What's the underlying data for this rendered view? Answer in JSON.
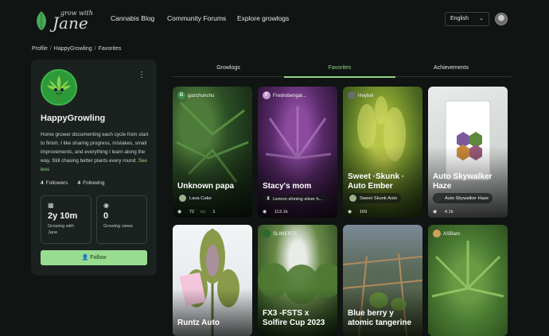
{
  "header": {
    "logo_small": "grow with",
    "logo_big": "Jane",
    "nav": [
      "Cannabis Blog",
      "Community Forums",
      "Explore growlogs"
    ],
    "language": "English"
  },
  "breadcrumb": [
    "Profile",
    "HappyGrowling",
    "Favorites"
  ],
  "profile": {
    "name": "HappyGrowling",
    "bio": "Home grower documenting each cycle from start to finish. I like sharing progress, mistakes, small improvements, and everything I learn along the way. Still chasing better plants every round.",
    "see_less": "See less",
    "followers_count": "4",
    "followers_label": "Followers",
    "following_count": "4",
    "following_label": "Following",
    "growing_value": "2y 10m",
    "growing_label": "Growing with Jane",
    "views_value": "0",
    "views_label": "Growlog views",
    "follow_label": "Follow"
  },
  "tabs": [
    "Growlogs",
    "Favorites",
    "Achievements"
  ],
  "active_tab": "Favorites",
  "cards": [
    {
      "author": "gazchunchu",
      "title": "Unknown papa",
      "strain": "Lava Cake",
      "views": "72",
      "comments": "1"
    },
    {
      "author": "Fredrobengal...",
      "title": "Stacy's mom",
      "strain": "Lemon shining silver h...",
      "views": "113.1k",
      "comments": ""
    },
    {
      "author": "Heybel",
      "title": "Sweet ·Skunk · Auto Ember",
      "strain": "Sweet Skunk Auto",
      "views": "169",
      "comments": ""
    },
    {
      "author": "",
      "title": "Auto Skywalker Haze",
      "strain": "Auto Skywalker Haze",
      "views": "4.1k",
      "comments": ""
    },
    {
      "author": "",
      "title": "Runtz Auto",
      "strain": "",
      "views": "",
      "comments": ""
    },
    {
      "author": "SLIMER75",
      "title": "FX3 -FSTS x Solfire Cup 2023",
      "strain": "",
      "views": "",
      "comments": ""
    },
    {
      "author": "",
      "title": "Blue berry y atomic tangerine",
      "strain": "",
      "views": "",
      "comments": ""
    },
    {
      "author": "ASBam",
      "title": "",
      "strain": "",
      "views": "",
      "comments": ""
    }
  ],
  "colors": {
    "accent": "#98dd8f",
    "background": "#101412",
    "card": "#1b211e"
  }
}
